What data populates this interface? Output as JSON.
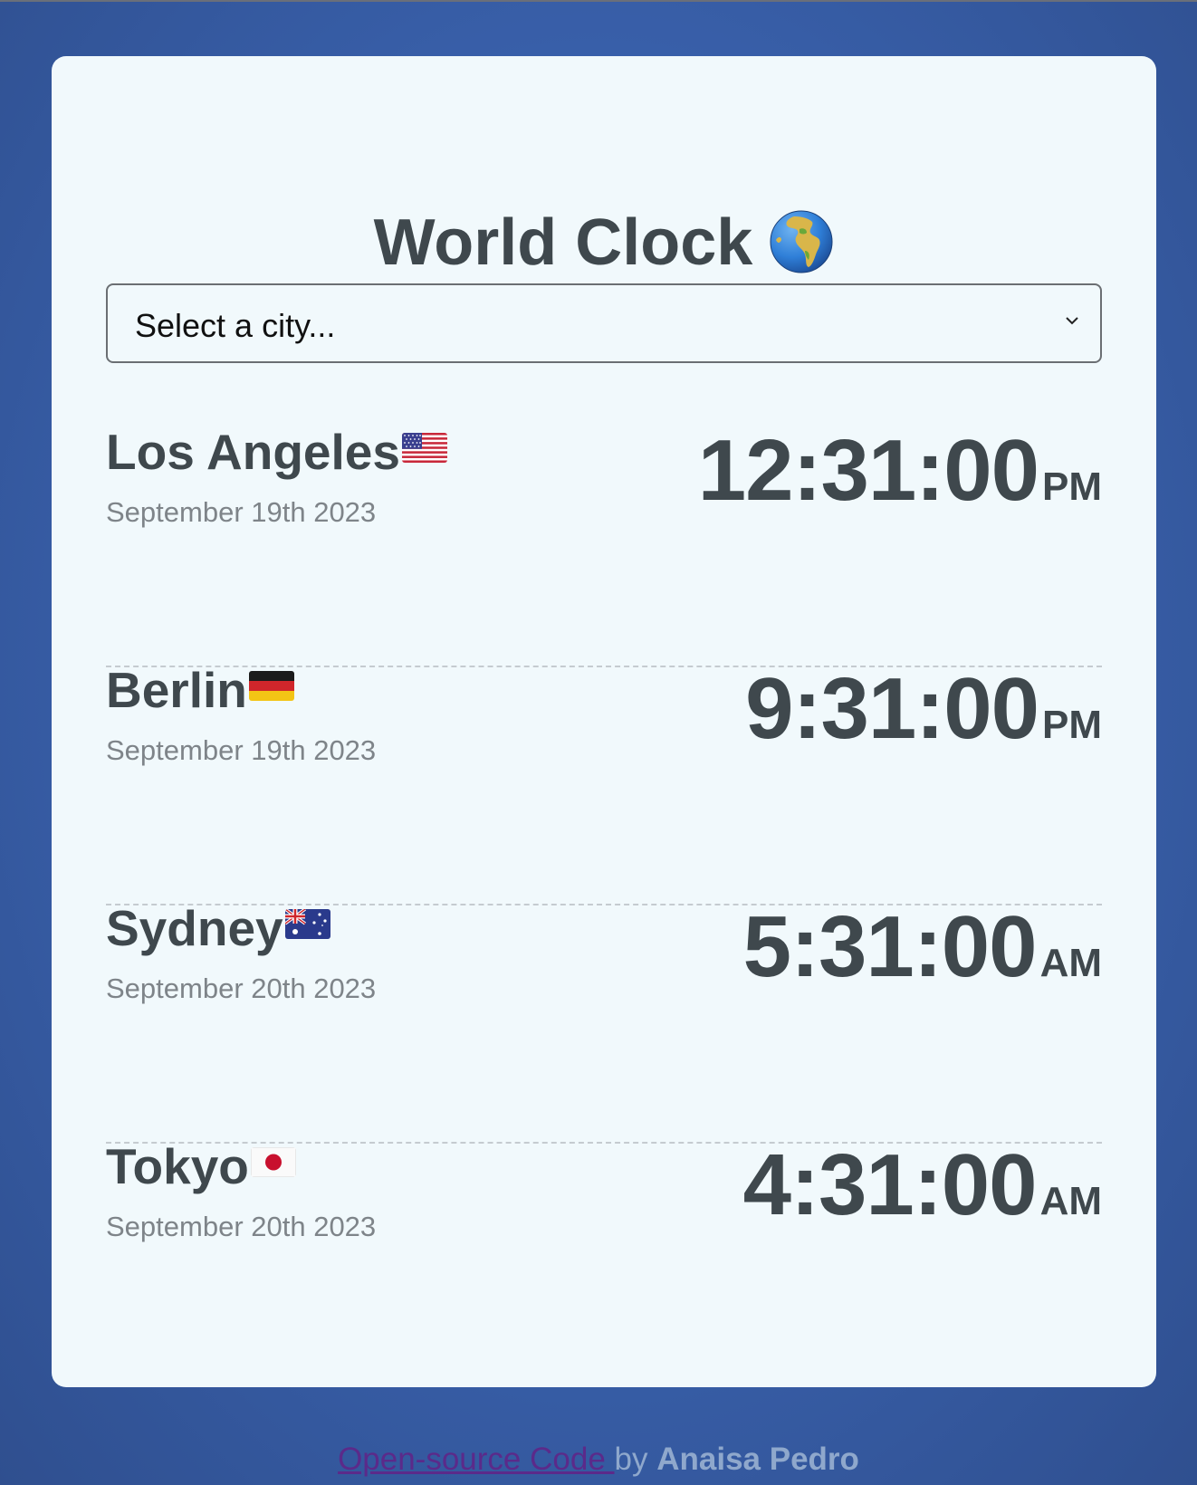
{
  "app": {
    "title": "World Clock"
  },
  "select": {
    "placeholder": "Select a city..."
  },
  "cities": [
    {
      "name": "Los Angeles",
      "flag": "us-flag-icon",
      "date": "September 19th 2023",
      "time": "12:31:00",
      "ampm": "PM"
    },
    {
      "name": "Berlin",
      "flag": "de-flag-icon",
      "date": "September 19th 2023",
      "time": "9:31:00",
      "ampm": "PM"
    },
    {
      "name": "Sydney",
      "flag": "au-flag-icon",
      "date": "September 20th 2023",
      "time": "5:31:00",
      "ampm": "AM"
    },
    {
      "name": "Tokyo",
      "flag": "jp-flag-icon",
      "date": "September 20th 2023",
      "time": "4:31:00",
      "ampm": "AM"
    }
  ],
  "footer": {
    "link_text": "Open-source Code ",
    "by_text": "by ",
    "author": "Anaisa Pedro"
  },
  "colors": {
    "background": "#3a62ae",
    "card": "#f1f9fc",
    "text_dark": "#3f484d",
    "text_muted": "#7e8489",
    "link": "#5b2a8a",
    "footer_text": "#8fa8cc"
  },
  "icons": {
    "title_icon": "globe-icon",
    "select_icon": "chevron-down-icon"
  }
}
